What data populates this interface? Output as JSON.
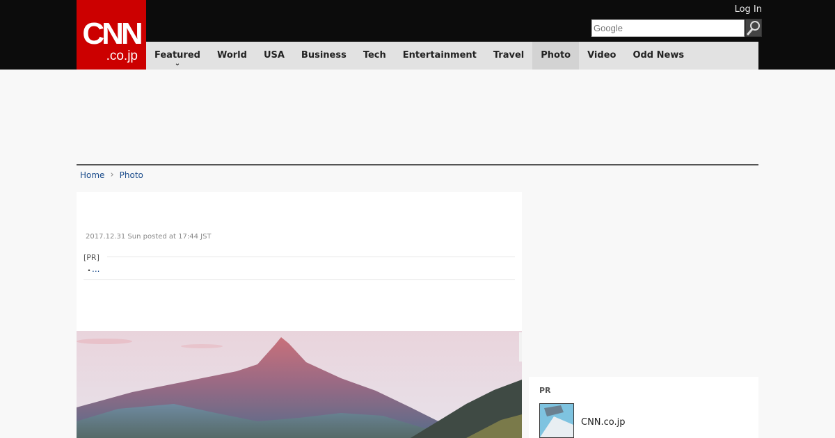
{
  "logo": {
    "main": "CNN",
    "sub": ".co.jp"
  },
  "header": {
    "login_label": "Log In",
    "search_placeholder": "Google"
  },
  "nav": [
    {
      "label": "Featured"
    },
    {
      "label": "World"
    },
    {
      "label": "USA"
    },
    {
      "label": "Business"
    },
    {
      "label": "Tech"
    },
    {
      "label": "Entertainment"
    },
    {
      "label": "Travel"
    },
    {
      "label": "Photo",
      "active": true
    },
    {
      "label": "Video"
    },
    {
      "label": "Odd News"
    }
  ],
  "breadcrumb": {
    "home": "Home",
    "current": "Photo"
  },
  "article": {
    "posted": "2017.12.31 Sun posted at 17:44 JST",
    "pr_label": "[PR]",
    "pr_bullet": "・",
    "pr_link": "..."
  },
  "sidebar": {
    "pr_label": "PR",
    "item_text": "CNN.co.jp"
  },
  "colors": {
    "brand_red": "#cc0000",
    "link_blue": "#1c4d8c",
    "topbar": "#0c0c0c"
  }
}
